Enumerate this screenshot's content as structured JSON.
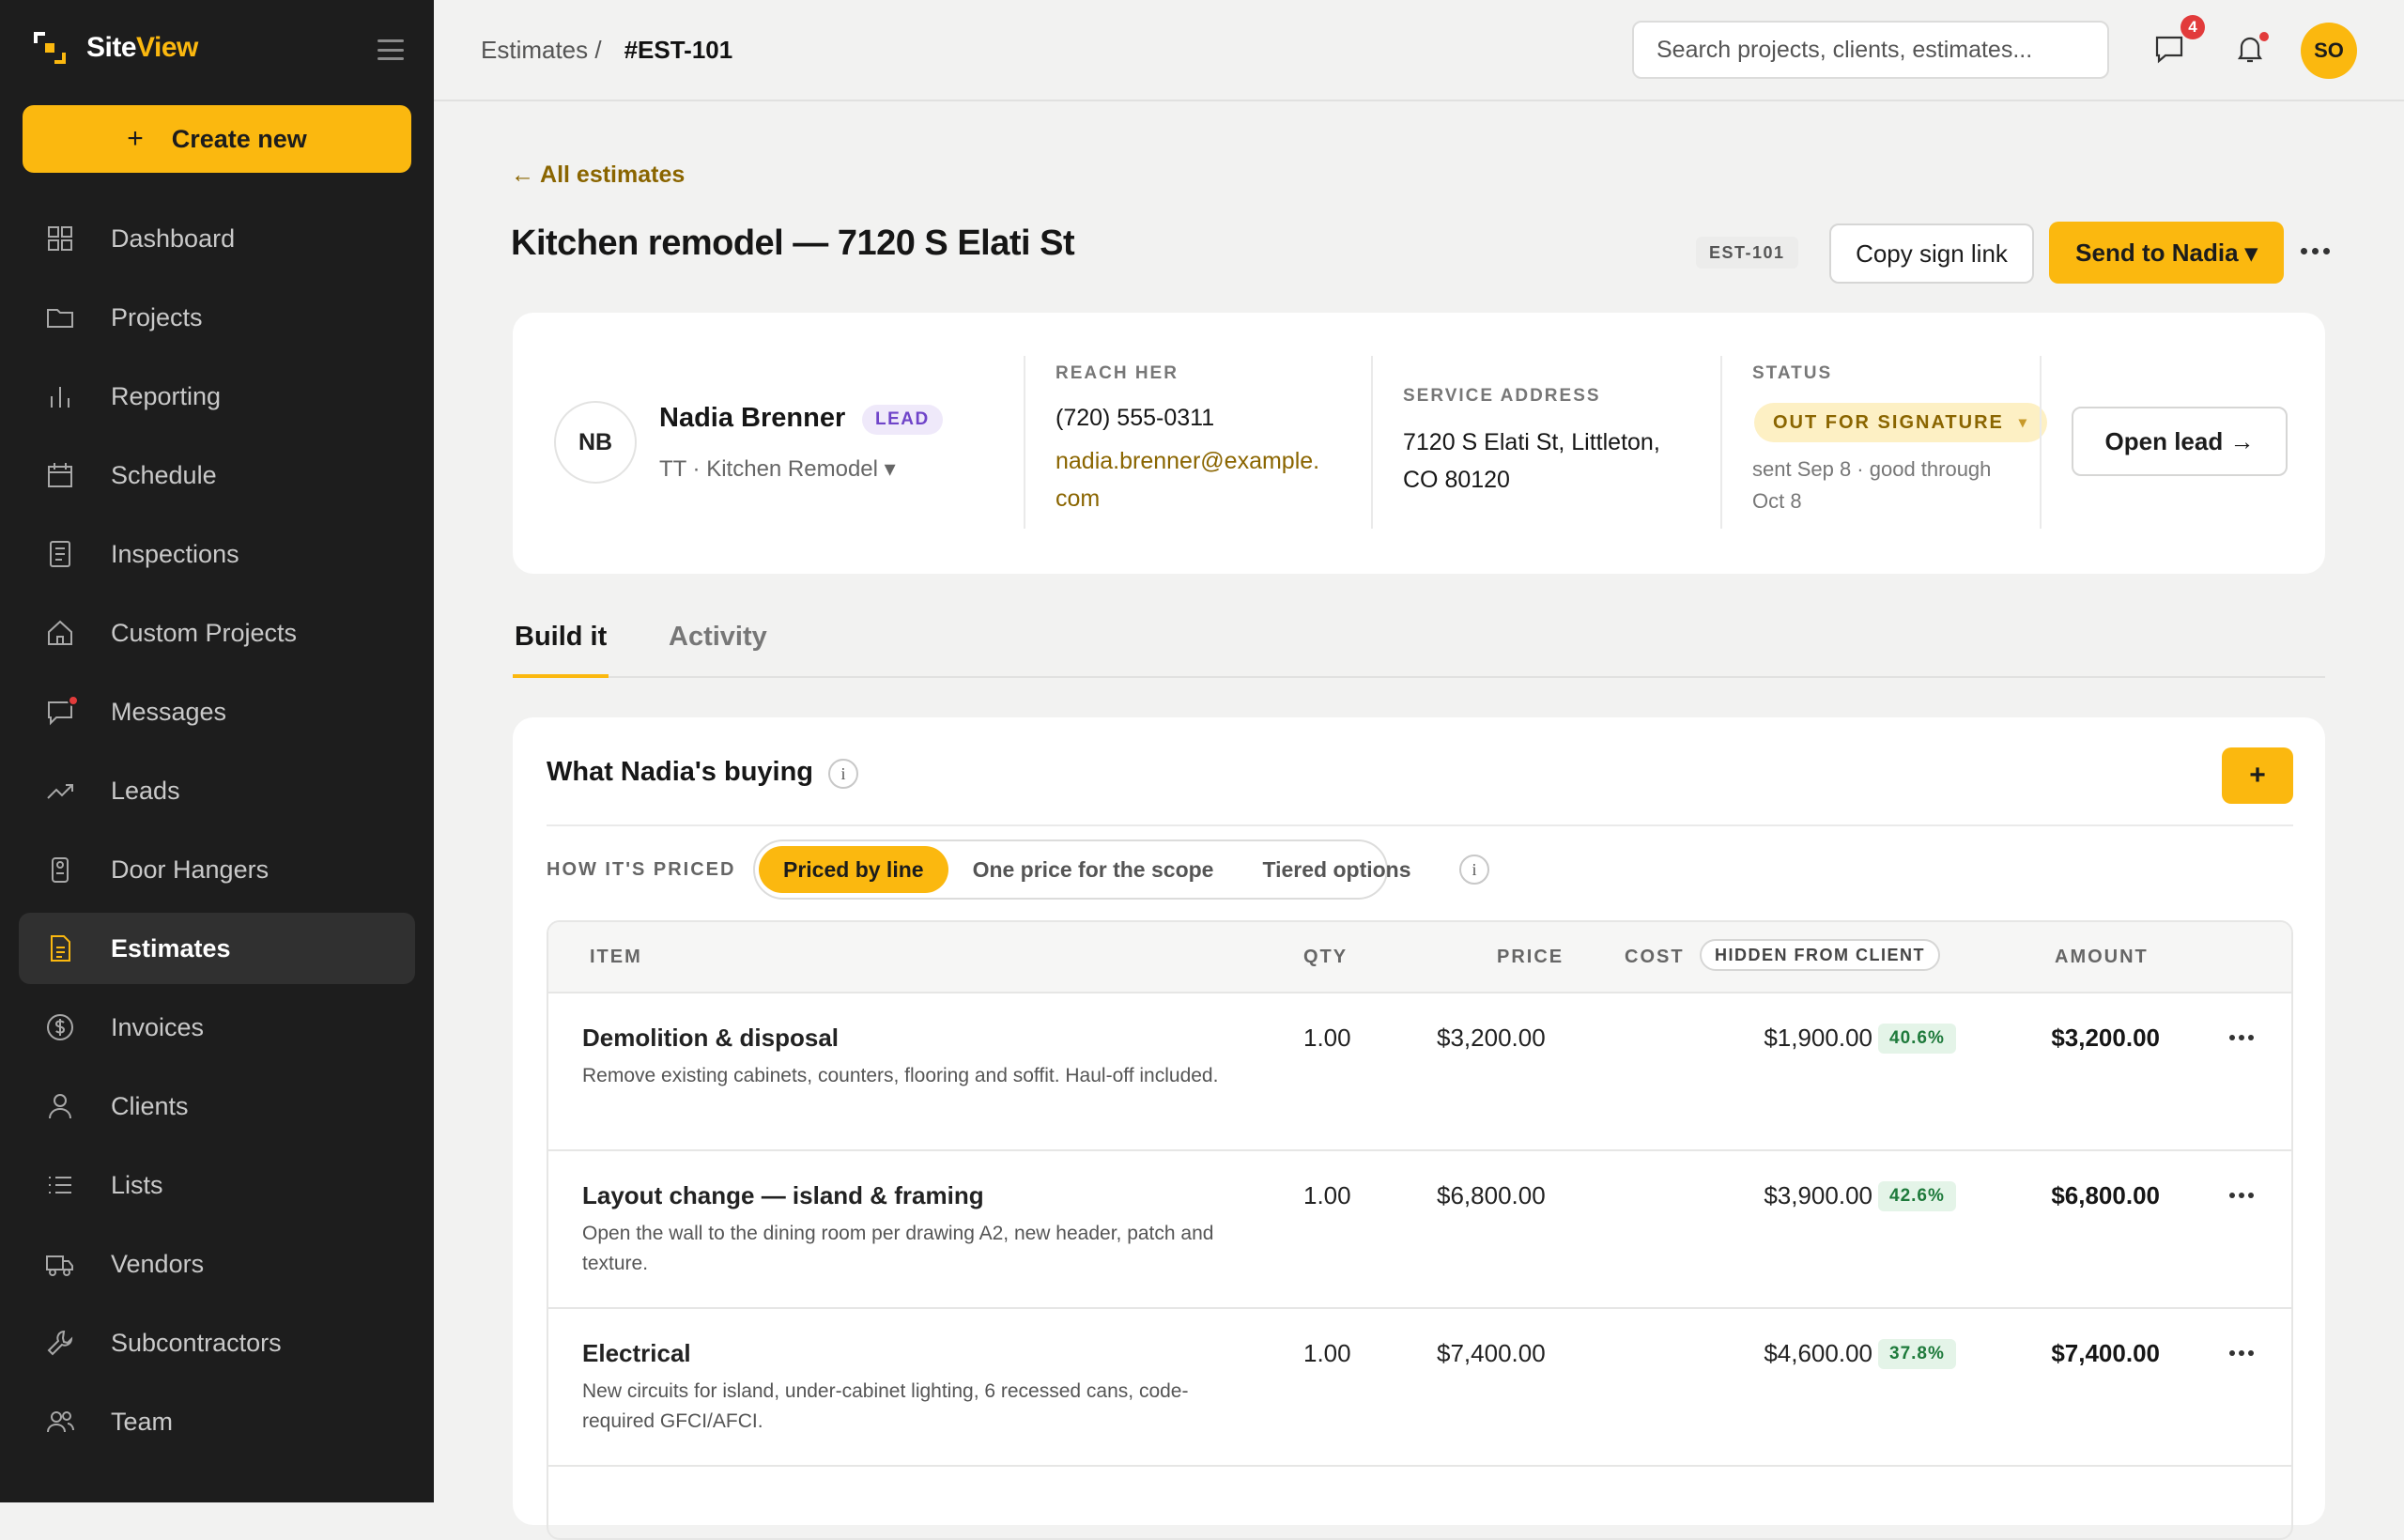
{
  "app": {
    "name_part1": "Site",
    "name_part2": "View"
  },
  "sidebar": {
    "create_label": "Create new",
    "items": [
      {
        "label": "Dashboard",
        "icon": "dashboard-icon"
      },
      {
        "label": "Projects",
        "icon": "folder-icon"
      },
      {
        "label": "Reporting",
        "icon": "bar-chart-icon"
      },
      {
        "label": "Schedule",
        "icon": "calendar-icon"
      },
      {
        "label": "Inspections",
        "icon": "document-icon"
      },
      {
        "label": "Custom Projects",
        "icon": "house-icon"
      },
      {
        "label": "Messages",
        "icon": "message-icon"
      },
      {
        "label": "Leads",
        "icon": "trend-up-icon"
      },
      {
        "label": "Door Hangers",
        "icon": "door-hanger-icon"
      },
      {
        "label": "Estimates",
        "icon": "estimate-icon",
        "active": true
      },
      {
        "label": "Invoices",
        "icon": "dollar-icon"
      },
      {
        "label": "Clients",
        "icon": "person-icon"
      },
      {
        "label": "Lists",
        "icon": "list-icon"
      },
      {
        "label": "Vendors",
        "icon": "truck-icon"
      },
      {
        "label": "Subcontractors",
        "icon": "wrench-icon"
      },
      {
        "label": "Team",
        "icon": "team-icon"
      }
    ]
  },
  "topbar": {
    "crumb_parent": "Estimates /",
    "crumb_current": "#EST-101",
    "search_placeholder": "Search projects, clients, estimates...",
    "message_count": "4",
    "user_initials": "SO"
  },
  "header": {
    "back_label": "← All estimates",
    "title": "Kitchen remodel — 7120 S Elati St",
    "estimate_tag": "EST-101",
    "copy_label": "Copy sign link",
    "send_label": "Send to Nadia ▾"
  },
  "client": {
    "initials": "NB",
    "name": "Nadia Brenner",
    "badge": "LEAD",
    "sub": "TT · Kitchen Remodel ▾",
    "reach_label": "REACH HER",
    "phone": "(720) 555-0311",
    "email_line1": "nadia.brenner@example.",
    "email_line2": "com",
    "address_label": "SERVICE ADDRESS",
    "address_line1": "7120 S Elati St, Littleton,",
    "address_line2": "CO 80120",
    "status_label": "STATUS",
    "status": "OUT FOR SIGNATURE",
    "status_caret": "▾",
    "status_note": "sent Sep 8 · good through Oct 8",
    "open_label": "Open lead →"
  },
  "tabs": [
    {
      "label": "Build it",
      "active": true
    },
    {
      "label": "Activity"
    }
  ],
  "builder": {
    "title": "What Nadia's buying",
    "info": "i",
    "add": "+",
    "pricing_label": "HOW IT'S PRICED",
    "pricing_options": [
      "Priced by line",
      "One price for the scope",
      "Tiered options"
    ],
    "pricing_selected": "Priced by line"
  },
  "table": {
    "headers": {
      "item": "ITEM",
      "qty": "QTY",
      "price": "PRICE",
      "cost": "COST",
      "hidden": "HIDDEN FROM CLIENT",
      "amount": "AMOUNT"
    },
    "rows": [
      {
        "name": "Demolition & disposal",
        "desc": "Remove existing cabinets, counters, flooring and soffit. Haul-off included.",
        "qty": "1.00",
        "price": "$3,200.00",
        "cost": "$1,900.00",
        "margin": "40.6%",
        "amount": "$3,200.00"
      },
      {
        "name": "Layout change — island & framing",
        "desc": "Open the wall to the dining room per drawing A2, new header, patch and texture.",
        "qty": "1.00",
        "price": "$6,800.00",
        "cost": "$3,900.00",
        "margin": "42.6%",
        "amount": "$6,800.00"
      },
      {
        "name": "Electrical",
        "desc": "New circuits for island, under-cabinet lighting, 6 recessed cans, code-required GFCI/AFCI.",
        "qty": "1.00",
        "price": "$7,400.00",
        "cost": "$4,600.00",
        "margin": "37.8%",
        "amount": "$7,400.00"
      }
    ]
  },
  "colors": {
    "accent": "#fbb80f",
    "sidebar_bg": "#1d1d1d",
    "link": "#8a6500",
    "margin_green": "#1e7a3b"
  }
}
